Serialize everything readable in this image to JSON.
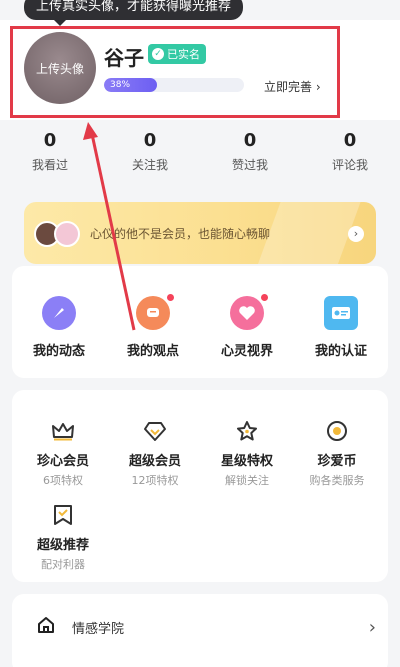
{
  "tooltip": "上传真实头像，才能获得曝光推荐",
  "profile": {
    "avatar_text": "上传头像",
    "name": "谷子",
    "verified_badge": "已实名",
    "progress_text": "38%",
    "progress": 0.38,
    "complete_link": "立即完善 ›"
  },
  "stats": [
    {
      "value": "0",
      "label": "我看过"
    },
    {
      "value": "0",
      "label": "关注我"
    },
    {
      "value": "0",
      "label": "赞过我"
    },
    {
      "value": "0",
      "label": "评论我"
    }
  ],
  "vip_banner": {
    "text": "心仪的他不是会员，也能随心畅聊",
    "arrow": "›"
  },
  "features": [
    {
      "label": "我的动态",
      "icon": "compass-icon",
      "color": "#8b7ff6",
      "reddot": false
    },
    {
      "label": "我的观点",
      "icon": "comment-icon",
      "color": "#f58a5a",
      "reddot": true
    },
    {
      "label": "心灵视界",
      "icon": "heart-icon",
      "color": "#f56f9c",
      "reddot": true
    },
    {
      "label": "我的认证",
      "icon": "id-card-icon",
      "color": "#4fb8f0",
      "reddot": false
    }
  ],
  "privileges": [
    {
      "title": "珍心会员",
      "sub": "6项特权",
      "icon": "crown-icon"
    },
    {
      "title": "超级会员",
      "sub": "12项特权",
      "icon": "diamond-icon"
    },
    {
      "title": "星级特权",
      "sub": "解锁关注",
      "icon": "star-icon"
    },
    {
      "title": "珍爱币",
      "sub": "购各类服务",
      "icon": "coin-icon"
    },
    {
      "title": "超级推荐",
      "sub": "配对利器",
      "icon": "recommend-icon"
    }
  ],
  "list": [
    {
      "label": "情感学院",
      "icon": "house-icon"
    }
  ],
  "colors": {
    "accent": "#6d5ff2",
    "verified": "#33c9a4",
    "annotation": "#e23a48"
  }
}
